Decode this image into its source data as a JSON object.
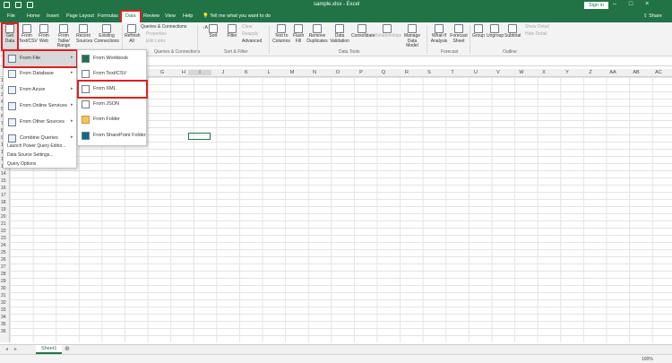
{
  "window": {
    "title": "sample.xlsx  -  Excel",
    "signin_label": "Sign in",
    "share_label": "Share"
  },
  "tabs": [
    "File",
    "Home",
    "Insert",
    "Page Layout",
    "Formulas",
    "Data",
    "Review",
    "View",
    "Help"
  ],
  "tell_me": "Tell me what you want to do",
  "ribbon": {
    "get_data": "Get Data",
    "from_text_csv": "From Text/CSV",
    "from_web": "From Web",
    "from_table_range": "From Table/ Range",
    "recent_sources": "Recent Sources",
    "existing_connections": "Existing Connections",
    "refresh_all": "Refresh All",
    "queries_connections": "Queries & Connections",
    "properties": "Properties",
    "edit_links": "Edit Links",
    "sort": "Sort",
    "filter": "Filter",
    "clear": "Clear",
    "reapply": "Reapply",
    "advanced": "Advanced",
    "text_to_columns": "Text to Columns",
    "flash_fill": "Flash Fill",
    "remove_duplicates": "Remove Duplicates",
    "data_validation": "Data Validation",
    "consolidate": "Consolidate",
    "relationships": "Relationships",
    "manage_data_model": "Manage Data Model",
    "what_if": "What-If Analysis",
    "forecast_sheet": "Forecast Sheet",
    "group": "Group",
    "ungroup": "Ungroup",
    "subtotal": "Subtotal",
    "show_detail": "Show Detail",
    "hide_detail": "Hide Detail",
    "groups": {
      "queries": "Queries & Connections",
      "sort_filter": "Sort & Filter",
      "data_tools": "Data Tools",
      "forecast": "Forecast",
      "outline": "Outline"
    }
  },
  "columns": [
    "I",
    "J",
    "K",
    "L",
    "M",
    "N",
    "O",
    "P",
    "Q",
    "R",
    "S",
    "T",
    "U",
    "V",
    "W",
    "X",
    "Y",
    "Z",
    "AA",
    "AB",
    "AC"
  ],
  "columns_left": [
    "G",
    "H"
  ],
  "rows": [
    "1",
    "2",
    "3",
    "4",
    "5",
    "6",
    "7",
    "8",
    "9",
    "10",
    "11",
    "12",
    "13",
    "14",
    "15",
    "16",
    "17",
    "18",
    "19",
    "20",
    "21",
    "22",
    "23",
    "24",
    "25",
    "26",
    "27",
    "28",
    "29",
    "30",
    "31",
    "32",
    "33",
    "34",
    "35",
    "36"
  ],
  "get_data_menu": [
    {
      "label": "From File"
    },
    {
      "label": "From Database"
    },
    {
      "label": "From Azure"
    },
    {
      "label": "From Online Services"
    },
    {
      "label": "From Other Sources"
    },
    {
      "label": "Combine Queries"
    }
  ],
  "get_data_links": [
    "Launch Power Query Editor...",
    "Data Source Settings...",
    "Query Options"
  ],
  "from_file_menu": [
    "From Workbook",
    "From Text/CSV",
    "From XML",
    "From JSON",
    "From Folder",
    "From SharePoint Folder"
  ],
  "sheet": {
    "tab": "Sheet1"
  },
  "status": {
    "zoom": "100%"
  }
}
